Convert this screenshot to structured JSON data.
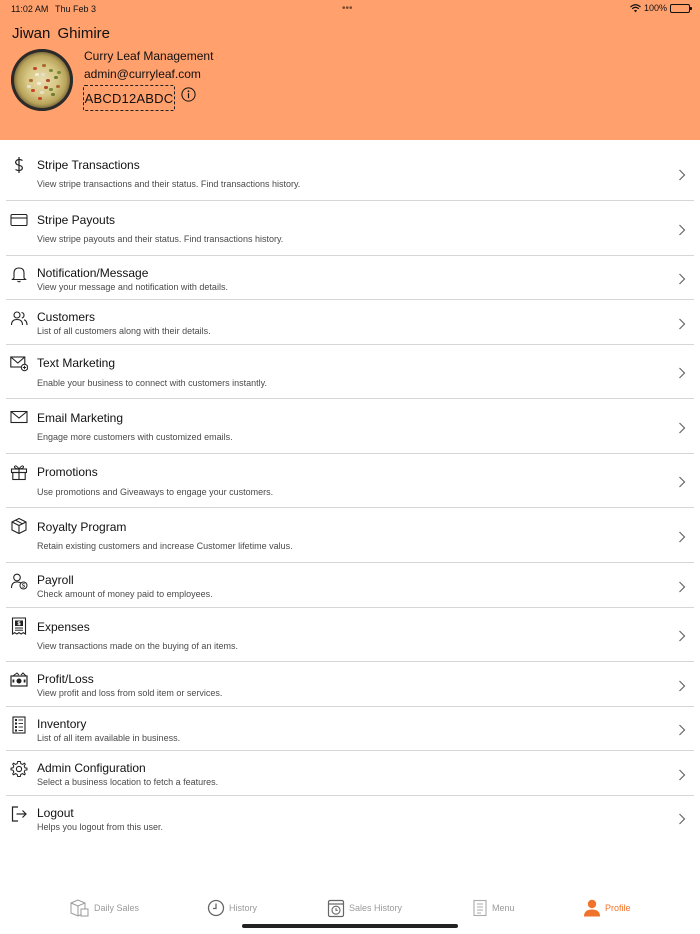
{
  "status_bar": {
    "time": "11:02 AM",
    "date": "Thu Feb 3",
    "battery": "100%",
    "battery_level": 1.0
  },
  "profile": {
    "name": "Jiwan  Ghimire",
    "business_name": "Curry Leaf Management",
    "email": "admin@curryleaf.com",
    "code": "ABCD12ABDC"
  },
  "menu": [
    {
      "icon": "dollar-icon",
      "title": "Stripe Transactions",
      "desc": "View stripe transactions and their status. Find transactions history."
    },
    {
      "icon": "credit-card-icon",
      "title": "Stripe Payouts",
      "desc": "View stripe payouts and their status. Find transactions history."
    },
    {
      "icon": "bell-icon",
      "title": "Notification/Message",
      "desc": "View your message and notification with details."
    },
    {
      "icon": "users-icon",
      "title": "Customers",
      "desc": "List of all customers along with their details."
    },
    {
      "icon": "envelope-add-icon",
      "title": "Text Marketing",
      "desc": "Enable your business to connect with customers instantly."
    },
    {
      "icon": "envelope-icon",
      "title": "Email Marketing",
      "desc": "Engage more customers with customized emails."
    },
    {
      "icon": "gift-icon",
      "title": "Promotions",
      "desc": "Use promotions and Giveaways to engage your customers."
    },
    {
      "icon": "box-icon",
      "title": "Royalty Program",
      "desc": "Retain existing customers and increase Customer lifetime valus."
    },
    {
      "icon": "payroll-icon",
      "title": "Payroll",
      "desc": "Check amount of money paid to employees."
    },
    {
      "icon": "receipt-icon",
      "title": "Expenses",
      "desc": "View transactions made on the buying of an items."
    },
    {
      "icon": "cash-icon",
      "title": "Profit/Loss",
      "desc": "View profit and loss from sold item or services."
    },
    {
      "icon": "inventory-icon",
      "title": "Inventory",
      "desc": "List of all item available in business."
    },
    {
      "icon": "gear-icon",
      "title": "Admin Configuration",
      "desc": "Select a business location to fetch a features."
    },
    {
      "icon": "logout-icon",
      "title": "Logout",
      "desc": "Helps you logout from this user."
    }
  ],
  "tabs": [
    {
      "icon": "daily-sales-icon",
      "label": "Daily Sales",
      "active": false
    },
    {
      "icon": "clock-icon",
      "label": "History",
      "active": false
    },
    {
      "icon": "calendar-clock-icon",
      "label": "Sales History",
      "active": false
    },
    {
      "icon": "menu-book-icon",
      "label": "Menu",
      "active": false
    },
    {
      "icon": "person-icon",
      "label": "Profile",
      "active": true
    }
  ],
  "colors": {
    "header_bg": "#ffa06d",
    "active_tab": "#f0732b",
    "inactive_tab": "#9a9a9a"
  }
}
